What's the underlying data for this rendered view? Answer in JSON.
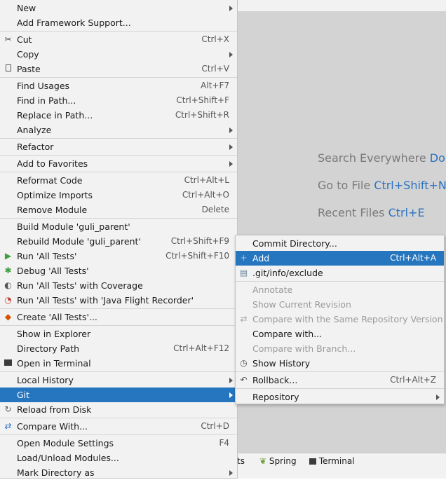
{
  "colors": {
    "accent": "#2675bf",
    "shortcut": "#2a73c0",
    "menu_bg": "#f2f2f2",
    "editor_bg": "#d3d3d3"
  },
  "hints": [
    {
      "text": "Search Everywhere ",
      "shortcut": "Doul"
    },
    {
      "text": "Go to File ",
      "shortcut": "Ctrl+Shift+N"
    },
    {
      "text": "Recent Files ",
      "shortcut": "Ctrl+E"
    }
  ],
  "bottom_bar": {
    "partial": "ts",
    "spring": "Spring",
    "terminal": "Terminal",
    "spring_icon": "leaf-icon",
    "terminal_icon": "terminal-icon"
  },
  "main_menu": {
    "new": "New",
    "add_framework": "Add Framework Support...",
    "cut": "Cut",
    "cut_sc": "Ctrl+X",
    "copy": "Copy",
    "paste": "Paste",
    "paste_sc": "Ctrl+V",
    "find_usages": "Find Usages",
    "find_usages_sc": "Alt+F7",
    "find_in_path": "Find in Path...",
    "find_in_path_sc": "Ctrl+Shift+F",
    "replace_in_path": "Replace in Path...",
    "replace_in_path_sc": "Ctrl+Shift+R",
    "analyze": "Analyze",
    "refactor": "Refactor",
    "add_favorites": "Add to Favorites",
    "reformat": "Reformat Code",
    "reformat_sc": "Ctrl+Alt+L",
    "optimize": "Optimize Imports",
    "optimize_sc": "Ctrl+Alt+O",
    "remove_module": "Remove Module",
    "remove_module_sc": "Delete",
    "build_module": "Build Module 'guli_parent'",
    "rebuild_module": "Rebuild Module 'guli_parent'",
    "rebuild_module_sc": "Ctrl+Shift+F9",
    "run_tests": "Run 'All Tests'",
    "run_tests_sc": "Ctrl+Shift+F10",
    "debug_tests": "Debug 'All Tests'",
    "run_coverage": "Run 'All Tests' with Coverage",
    "run_jfr": "Run 'All Tests' with 'Java Flight Recorder'",
    "create_tests": "Create 'All Tests'...",
    "show_explorer": "Show in Explorer",
    "directory_path": "Directory Path",
    "directory_path_sc": "Ctrl+Alt+F12",
    "open_terminal": "Open in Terminal",
    "local_history": "Local History",
    "git": "Git",
    "reload_disk": "Reload from Disk",
    "compare_with": "Compare With...",
    "compare_with_sc": "Ctrl+D",
    "module_settings": "Open Module Settings",
    "module_settings_sc": "F4",
    "load_unload": "Load/Unload Modules...",
    "mark_directory": "Mark Directory as"
  },
  "git_menu": {
    "commit_dir": "Commit Directory...",
    "add": "Add",
    "add_sc": "Ctrl+Alt+A",
    "git_exclude": ".git/info/exclude",
    "annotate": "Annotate",
    "show_revision": "Show Current Revision",
    "compare_same_repo": "Compare with the Same Repository Version",
    "compare_with": "Compare with...",
    "compare_branch": "Compare with Branch...",
    "show_history": "Show History",
    "rollback": "Rollback...",
    "rollback_sc": "Ctrl+Alt+Z",
    "repository": "Repository"
  }
}
